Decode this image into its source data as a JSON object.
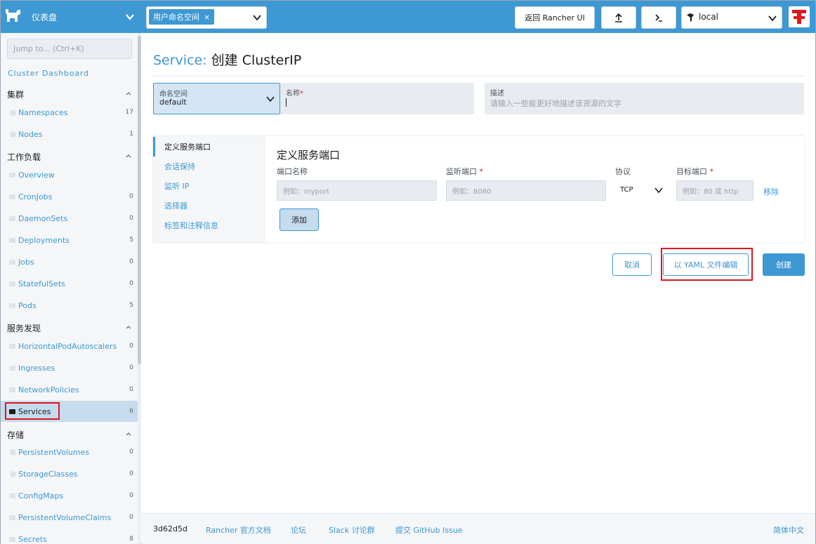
{
  "topbar": {
    "title": "仪表盘",
    "namespace_tag": "用户命名空间",
    "namespace_tag_close": "×",
    "back_label": "返回 Rancher UI",
    "cluster_label": "local"
  },
  "sidebar": {
    "jump_placeholder": "Jump to... (Ctrl+K)",
    "cluster_dashboard": "Cluster Dashboard",
    "groups": [
      {
        "label": "集群"
      },
      {
        "label": "工作负载"
      },
      {
        "label": "服务发现"
      },
      {
        "label": "存储"
      }
    ],
    "items": [
      {
        "label": "Namespaces",
        "count": "17"
      },
      {
        "label": "Nodes",
        "count": "1"
      },
      {
        "label": "Overview",
        "count": ""
      },
      {
        "label": "CronJobs",
        "count": "0"
      },
      {
        "label": "DaemonSets",
        "count": "0"
      },
      {
        "label": "Deployments",
        "count": "5"
      },
      {
        "label": "Jobs",
        "count": "0"
      },
      {
        "label": "StatefulSets",
        "count": "0"
      },
      {
        "label": "Pods",
        "count": "5"
      },
      {
        "label": "HorizontalPodAutoscalers",
        "count": "0"
      },
      {
        "label": "Ingresses",
        "count": "0"
      },
      {
        "label": "NetworkPolicies",
        "count": "0"
      },
      {
        "label": "Services",
        "count": "6"
      },
      {
        "label": "PersistentVolumes",
        "count": "0"
      },
      {
        "label": "StorageClasses",
        "count": "0"
      },
      {
        "label": "ConfigMaps",
        "count": "0"
      },
      {
        "label": "PersistentVolumeClaims",
        "count": "0"
      },
      {
        "label": "Secrets",
        "count": "8"
      }
    ]
  },
  "main": {
    "title_prefix": "Service:",
    "title_rest": "创建 ClusterIP",
    "namespace_label": "命名空间",
    "namespace_value": "default",
    "name_label": "名称",
    "required_mark": "*",
    "desc_label": "描述",
    "desc_placeholder": "请输入一些能更好地描述该资源的文字",
    "tabs": [
      {
        "label": "定义服务端口"
      },
      {
        "label": "会话保持"
      },
      {
        "label": "监听 IP"
      },
      {
        "label": "选择器"
      },
      {
        "label": "标签和注释信息"
      }
    ],
    "section_title": "定义服务端口",
    "cols": {
      "port_name": "端口名称",
      "listen_port": "监听端口",
      "protocol": "协议",
      "target_port": "目标端口"
    },
    "port_name_placeholder": "例如：myport",
    "listen_port_placeholder": "例如：8080",
    "protocol_value": "TCP",
    "target_port_placeholder": "例如：80 或 http",
    "remove_label": "移除",
    "add_label": "添加",
    "cancel_label": "取消",
    "yaml_label": "以 YAML 文件编辑",
    "create_label": "创建"
  },
  "footer": {
    "version": "3d62d5d",
    "docs": "Rancher 官方文档",
    "forum": "论坛",
    "slack": "Slack 讨论群",
    "github": "提交 GitHub Issue",
    "language": "简体中文"
  }
}
